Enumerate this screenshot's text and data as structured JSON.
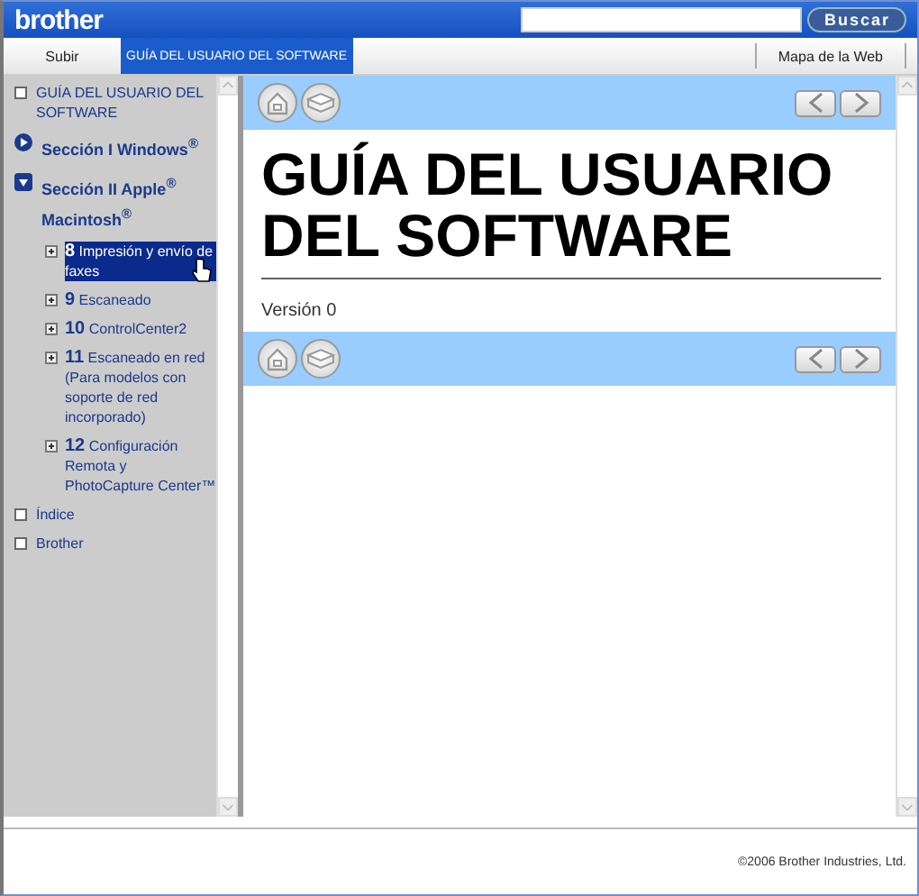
{
  "header": {
    "logo": "brother",
    "search_button": "Buscar"
  },
  "tabs": [
    {
      "label": "Subir",
      "selected": false
    },
    {
      "label": "GUÍA DEL USUARIO DEL SOFTWARE",
      "selected": true
    },
    {
      "label": "Mapa de la Web",
      "selected": false
    }
  ],
  "sidebar": {
    "items": [
      {
        "kind": "page",
        "label": "GUÍA DEL USUARIO DEL SOFTWARE"
      },
      {
        "kind": "section",
        "label": "Sección I Windows$^{®}$",
        "expanded": false
      },
      {
        "kind": "section",
        "label": "Sección II Apple$^{®}$ Macintosh$^{®}$",
        "expanded": true,
        "children": [
          {
            "kind": "chapter",
            "number": "8",
            "label": "Impresión y envío de faxes",
            "selected": true
          },
          {
            "kind": "chapter",
            "number": "9",
            "label": "Escaneado",
            "selected": false
          },
          {
            "kind": "chapter",
            "number": "10",
            "label": "ControlCenter2",
            "selected": false
          },
          {
            "kind": "chapter",
            "number": "11",
            "label": "Escaneado en red (Para modelos con soporte de red incorporado)",
            "selected": false
          },
          {
            "kind": "chapter",
            "number": "12",
            "label": "Configuración Remota y PhotoCapture Center™",
            "selected": false
          }
        ]
      },
      {
        "kind": "page",
        "label": "Índice"
      },
      {
        "kind": "page",
        "label": "Brother"
      }
    ]
  },
  "content": {
    "title": "GUÍA DEL USUARIO DEL SOFTWARE",
    "version": "Versión 0"
  },
  "footer": {
    "copyright": "©2006 Brother Industries, Ltd."
  }
}
